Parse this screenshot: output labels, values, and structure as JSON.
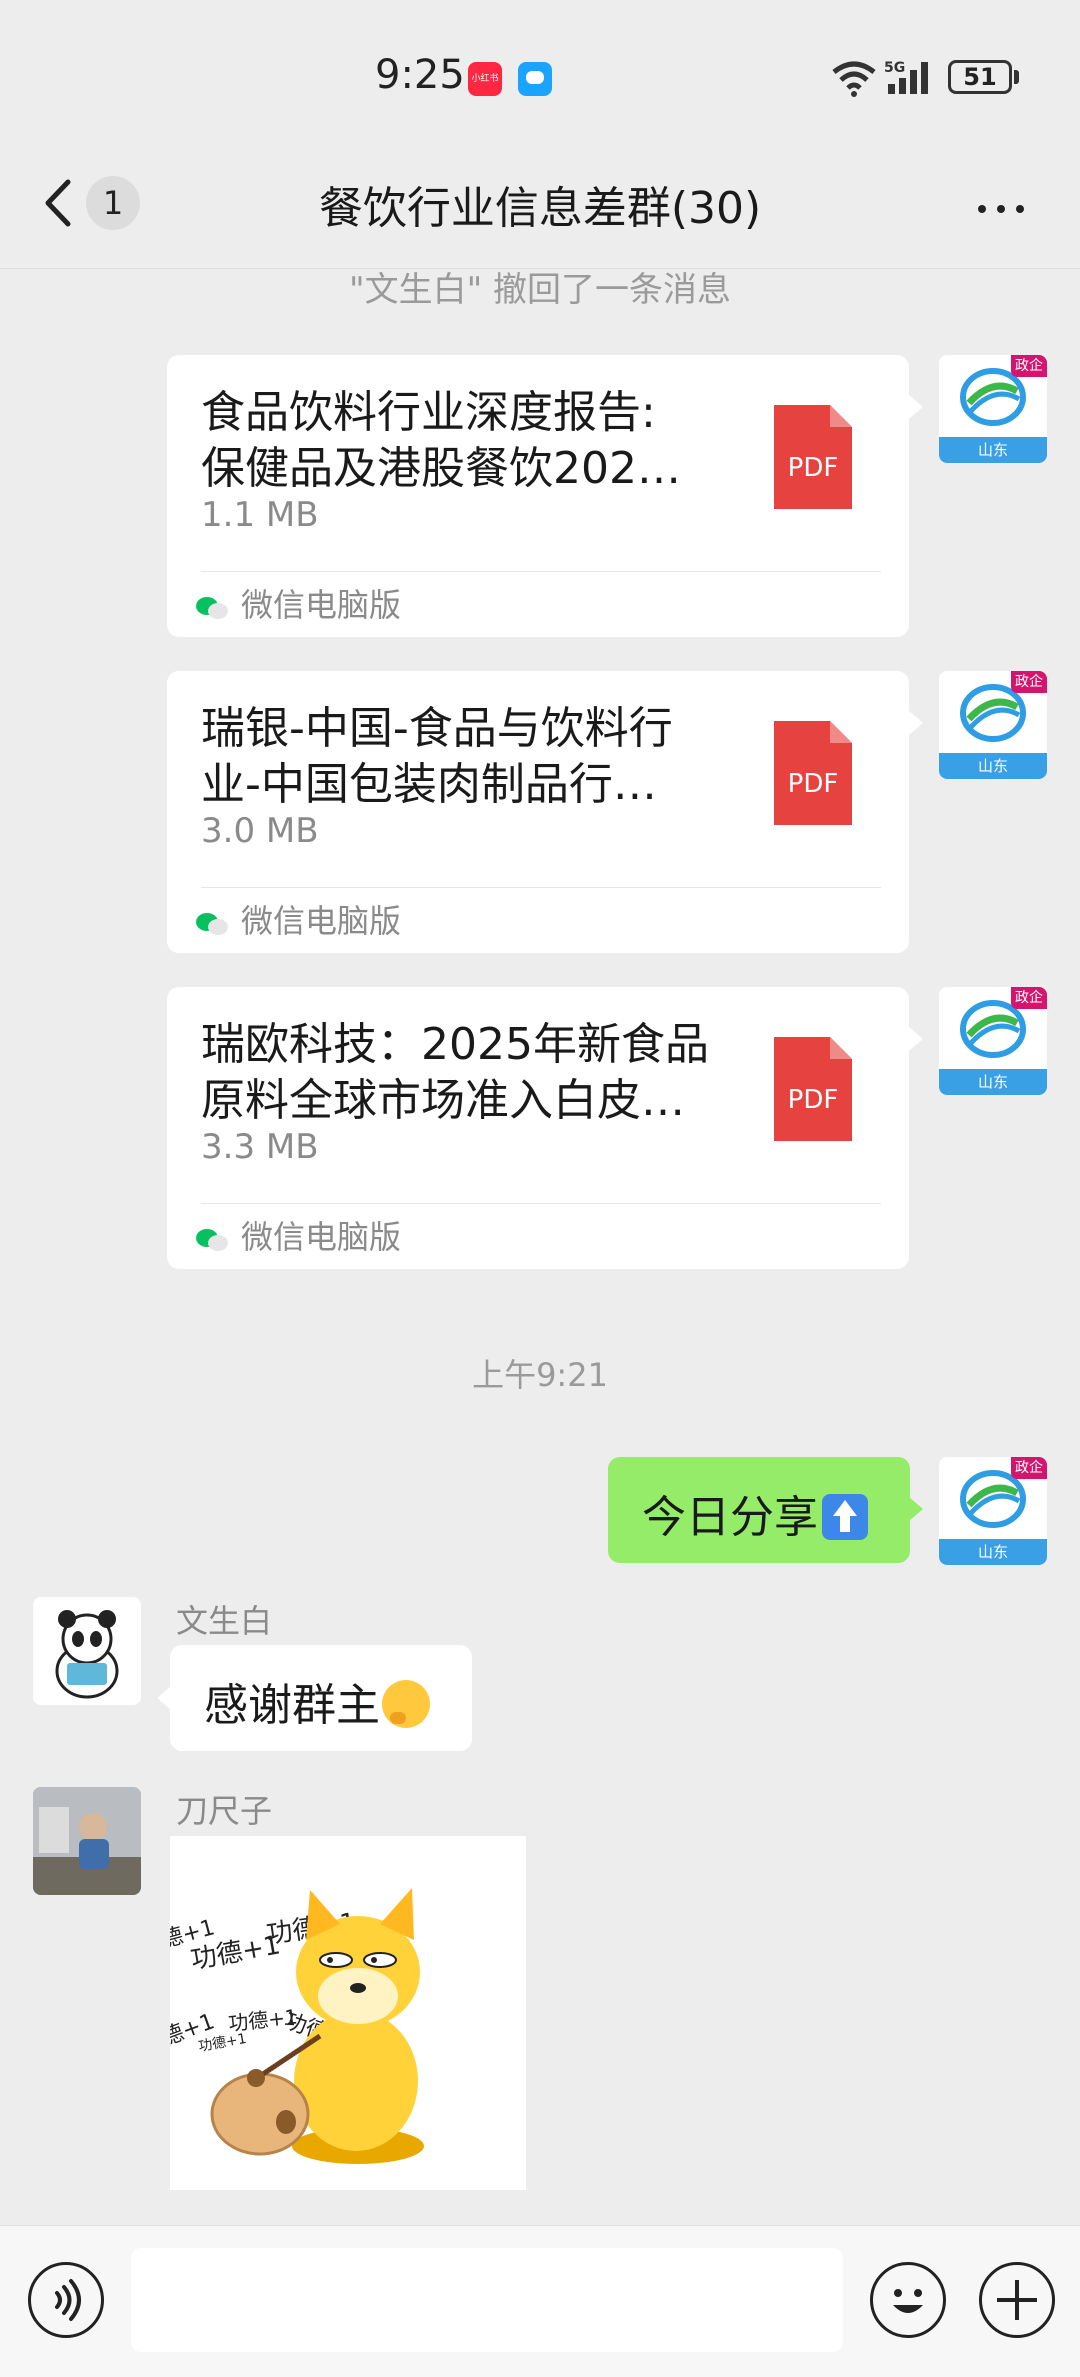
{
  "status_bar": {
    "time": "9:25",
    "app_badge_text": "小红书",
    "battery": "51",
    "network": "5G"
  },
  "header": {
    "unread_count": "1",
    "title": "餐饮行业信息差群(30)"
  },
  "recall_notice": "\"文生白\" 撤回了一条消息",
  "file_messages": [
    {
      "name_line1": "食品饮料行业深度报告:",
      "name_line2": "保健品及港股餐饮202…",
      "size": "1.1 MB",
      "file_type": "PDF",
      "source": "微信电脑版"
    },
    {
      "name_line1": "瑞银-中国-食品与饮料行",
      "name_line2": "业-中国包装肉制品行…",
      "size": "3.0 MB",
      "file_type": "PDF",
      "source": "微信电脑版"
    },
    {
      "name_line1": "瑞欧科技：2025年新食品",
      "name_line2": "原料全球市场准入白皮…",
      "size": "3.3 MB",
      "file_type": "PDF",
      "source": "微信电脑版"
    }
  ],
  "my_avatar": {
    "tag": "政企",
    "region": "山东"
  },
  "time_divider": "上午9:21",
  "sent_message": {
    "text": "今日分享"
  },
  "received_messages": [
    {
      "sender": "文生白",
      "text": "感谢群主"
    },
    {
      "sender": "刀尺子",
      "sticker_words": [
        "功德+1",
        "功德+1",
        "德+1",
        "功德+1",
        "德+1",
        "功德+1",
        "功德+1",
        "功德+1"
      ]
    }
  ],
  "colors": {
    "background": "#ededed",
    "sent_bubble": "#95ec69",
    "pdf_red": "#e64340",
    "wechat_green": "#07c160",
    "tag_magenta": "#d4146d"
  }
}
